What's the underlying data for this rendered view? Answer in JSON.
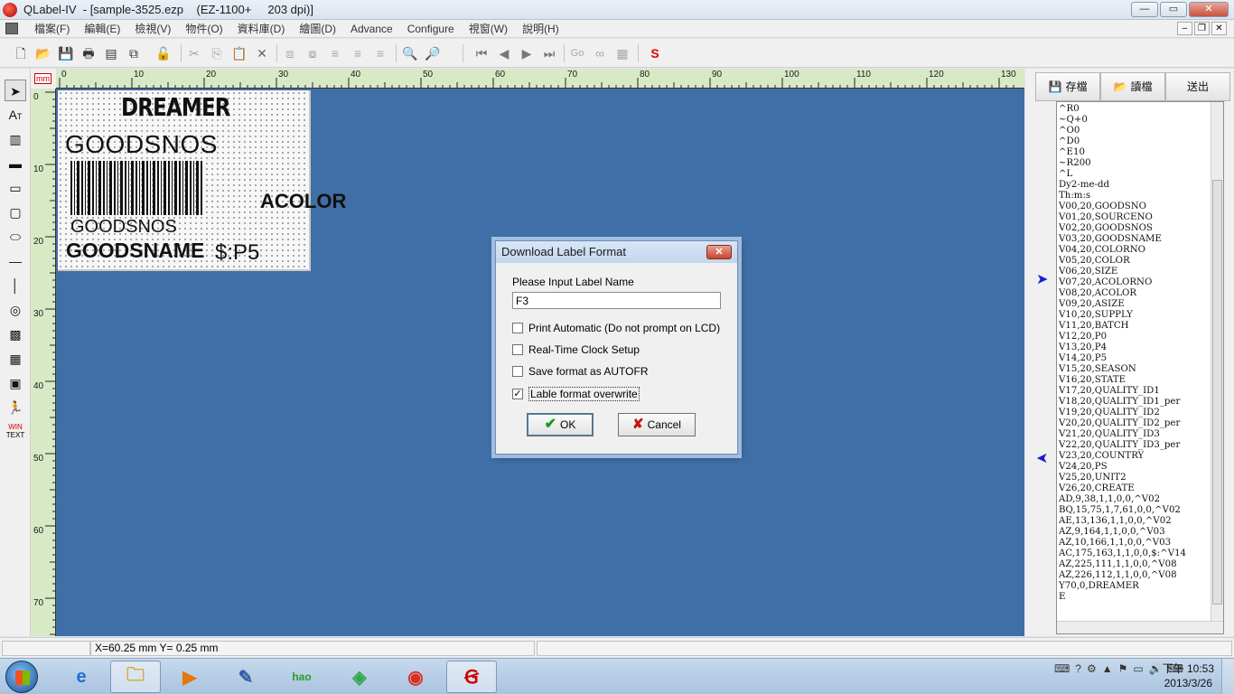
{
  "window": {
    "title": "QLabel-IV  - [sample-3525.ezp    (EZ-1100+     203 dpi)]",
    "minimize": "—",
    "maximize": "▭",
    "close": "✕"
  },
  "menu": {
    "items": [
      "檔案(F)",
      "編輯(E)",
      "檢視(V)",
      "物件(O)",
      "資料庫(D)",
      "繪圖(D)",
      "Advance",
      "Configure",
      "視窗(W)",
      "說明(H)"
    ],
    "mdi_min": "–",
    "mdi_restore": "❐",
    "mdi_close": "✕"
  },
  "toolbar": {
    "go_label": "Go"
  },
  "ruler": {
    "unit": "mm",
    "h_ticks": [
      "0",
      "10",
      "20",
      "30",
      "40",
      "50",
      "60",
      "70",
      "80",
      "90",
      "100",
      "110",
      "120",
      "130"
    ],
    "v_ticks": [
      "0",
      "10",
      "20",
      "30",
      "40",
      "50",
      "60",
      "70"
    ]
  },
  "label": {
    "brand": "DREAMER",
    "goodsnos_large": "GOODSNOS",
    "goodsnos_small": "GOODSNOS",
    "goodsname": "GOODSNAME",
    "price": "$:P5",
    "acolor": "ACOLOR"
  },
  "right_panel": {
    "save_label": "存檔",
    "read_label": "讀檔",
    "send_label": "送出",
    "code_lines": [
      "^R0",
      "~Q+0",
      "^O0",
      "^D0",
      "^E10",
      "~R200",
      "^L",
      "Dy2-me-dd",
      "Th:m:s",
      "V00,20,GOODSNO",
      "V01,20,SOURCENO",
      "V02,20,GOODSNOS",
      "V03,20,GOODSNAME",
      "V04,20,COLORNO",
      "V05,20,COLOR",
      "V06,20,SIZE",
      "V07,20,ACOLORNO",
      "V08,20,ACOLOR",
      "V09,20,ASIZE",
      "V10,20,SUPPLY",
      "V11,20,BATCH",
      "V12,20,P0",
      "V13,20,P4",
      "V14,20,P5",
      "V15,20,SEASON",
      "V16,20,STATE",
      "V17,20,QUALITY_ID1",
      "V18,20,QUALITY_ID1_per",
      "V19,20,QUALITY_ID2",
      "V20,20,QUALITY_ID2_per",
      "V21,20,QUALITY_ID3",
      "V22,20,QUALITY_ID3_per",
      "V23,20,COUNTRY",
      "V24,20,PS",
      "V25,20,UNIT2",
      "V26,20,CREATE",
      "AD,9,38,1,1,0,0,^V02",
      "BQ,15,75,1,7,61,0,0,^V02",
      "AE,13,136,1,1,0,0,^V02",
      "AZ,9,164,1,1,0,0,^V03",
      "AZ,10,166,1,1,0,0,^V03",
      "AC,175,163,1,1,0,0,$:^V14",
      "AZ,225,111,1,1,0,0,^V08",
      "AZ,226,112,1,1,0,0,^V08",
      "Y70,0,DREAMER",
      "E"
    ]
  },
  "status": {
    "coords": "X=60.25 mm  Y= 0.25 mm"
  },
  "dialog": {
    "title": "Download Label Format",
    "prompt": "Please Input Label Name",
    "label_name": "F3",
    "chk_print_auto": "Print Automatic (Do not prompt on LCD)",
    "chk_rtc": "Real-Time Clock Setup",
    "chk_autofr": "Save format as AUTOFR",
    "chk_overwrite": "Lable format overwrite",
    "overwrite_checked": true,
    "ok_label": "OK",
    "cancel_label": "Cancel"
  },
  "taskbar": {
    "clock_time": "下午 10:53",
    "clock_date": "2013/3/26",
    "hao_label": "hao"
  },
  "colors": {
    "canvas": "#3f6fa6",
    "ruler": "#d8e9c6"
  }
}
